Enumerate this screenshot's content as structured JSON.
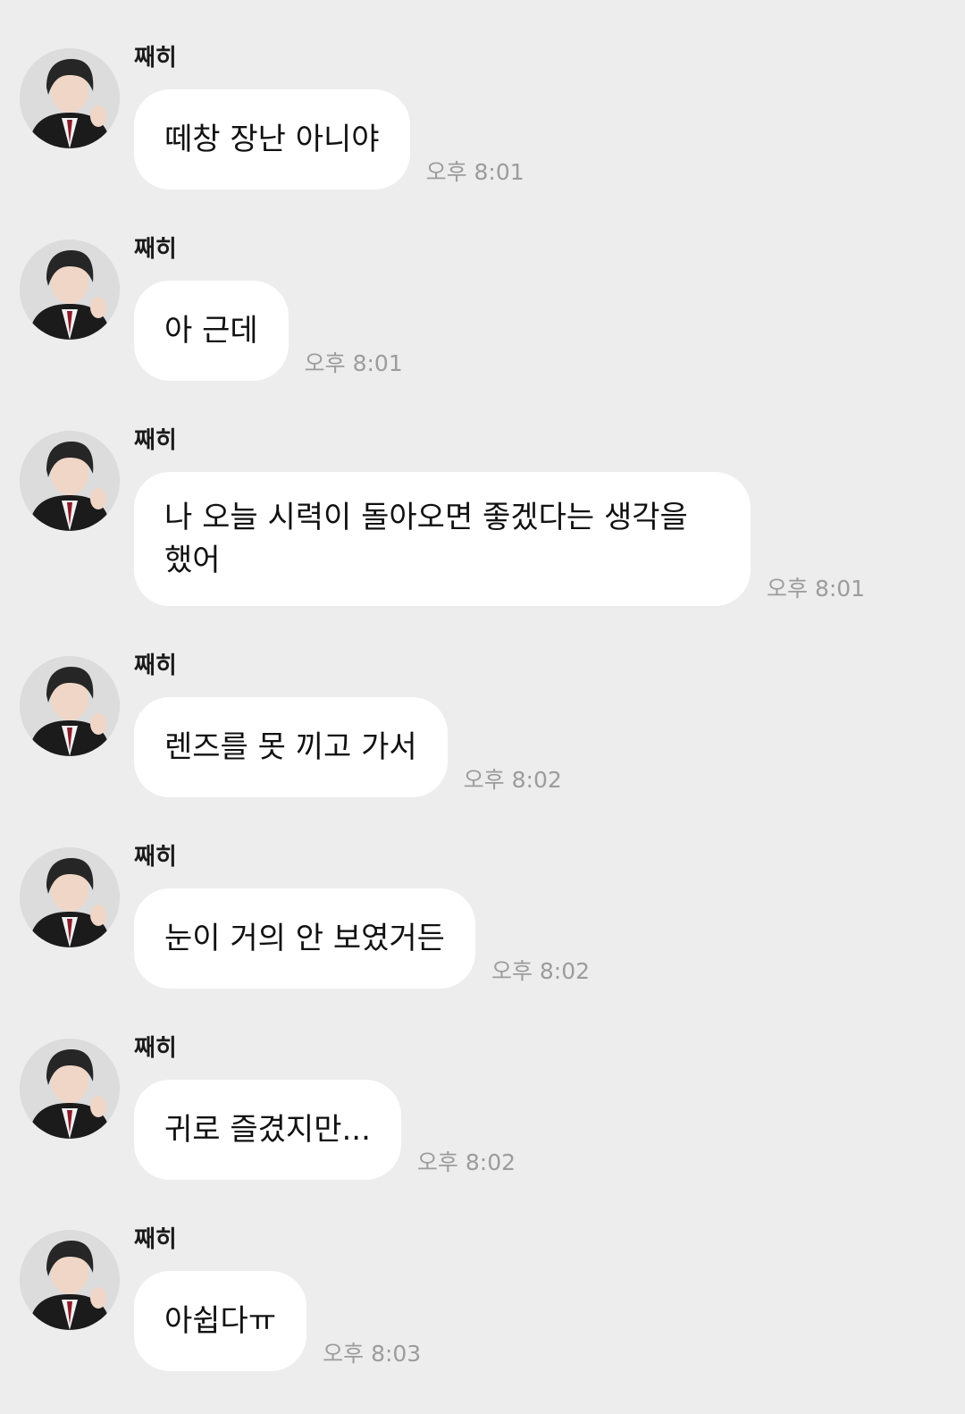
{
  "chat": {
    "sender": "째히",
    "messages": [
      {
        "text": "떼창 장난 아니야",
        "time": "오후 8:01"
      },
      {
        "text": "아 근데",
        "time": "오후 8:01"
      },
      {
        "text": "나 오늘 시력이 돌아오면 좋겠다는 생각을\n했어",
        "time": "오후 8:01"
      },
      {
        "text": "렌즈를 못 끼고 가서",
        "time": "오후 8:02"
      },
      {
        "text": "눈이 거의 안 보였거든",
        "time": "오후 8:02"
      },
      {
        "text": "귀로 즐겼지만...",
        "time": "오후 8:02"
      },
      {
        "text": "아쉽다ㅠ",
        "time": "오후 8:03"
      }
    ]
  },
  "colors": {
    "background": "#ededed",
    "bubble": "#ffffff",
    "timestamp": "#9c9c9c"
  },
  "icons": {
    "avatar": "profile-photo-icon"
  }
}
